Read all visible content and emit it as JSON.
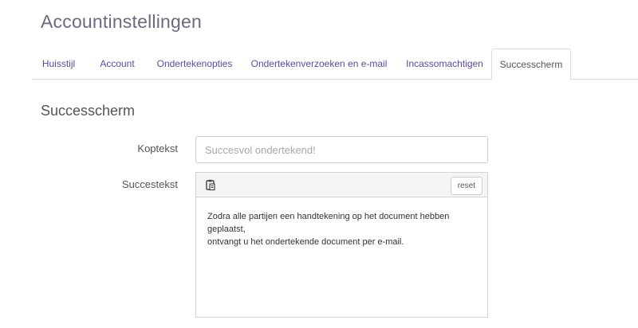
{
  "page": {
    "title": "Accountinstellingen"
  },
  "tabs": [
    {
      "label": "Huisstijl",
      "active": false
    },
    {
      "label": "Account",
      "active": false
    },
    {
      "label": "Ondertekenopties",
      "active": false
    },
    {
      "label": "Ondertekenverzoeken en e-mail",
      "active": false
    },
    {
      "label": "Incassomachtigen",
      "active": false
    },
    {
      "label": "Successcherm",
      "active": true
    }
  ],
  "section": {
    "title": "Successcherm"
  },
  "form": {
    "koptekst": {
      "label": "Koptekst",
      "placeholder": "Succesvol ondertekend!",
      "value": ""
    },
    "succestekst": {
      "label": "Succestekst",
      "toolbar_icon": "paste-icon",
      "reset_label": "reset",
      "line1": "Zodra alle partijen een handtekening op het document hebben geplaatst,",
      "line2": "ontvangt u het ondertekende document per e-mail."
    }
  }
}
